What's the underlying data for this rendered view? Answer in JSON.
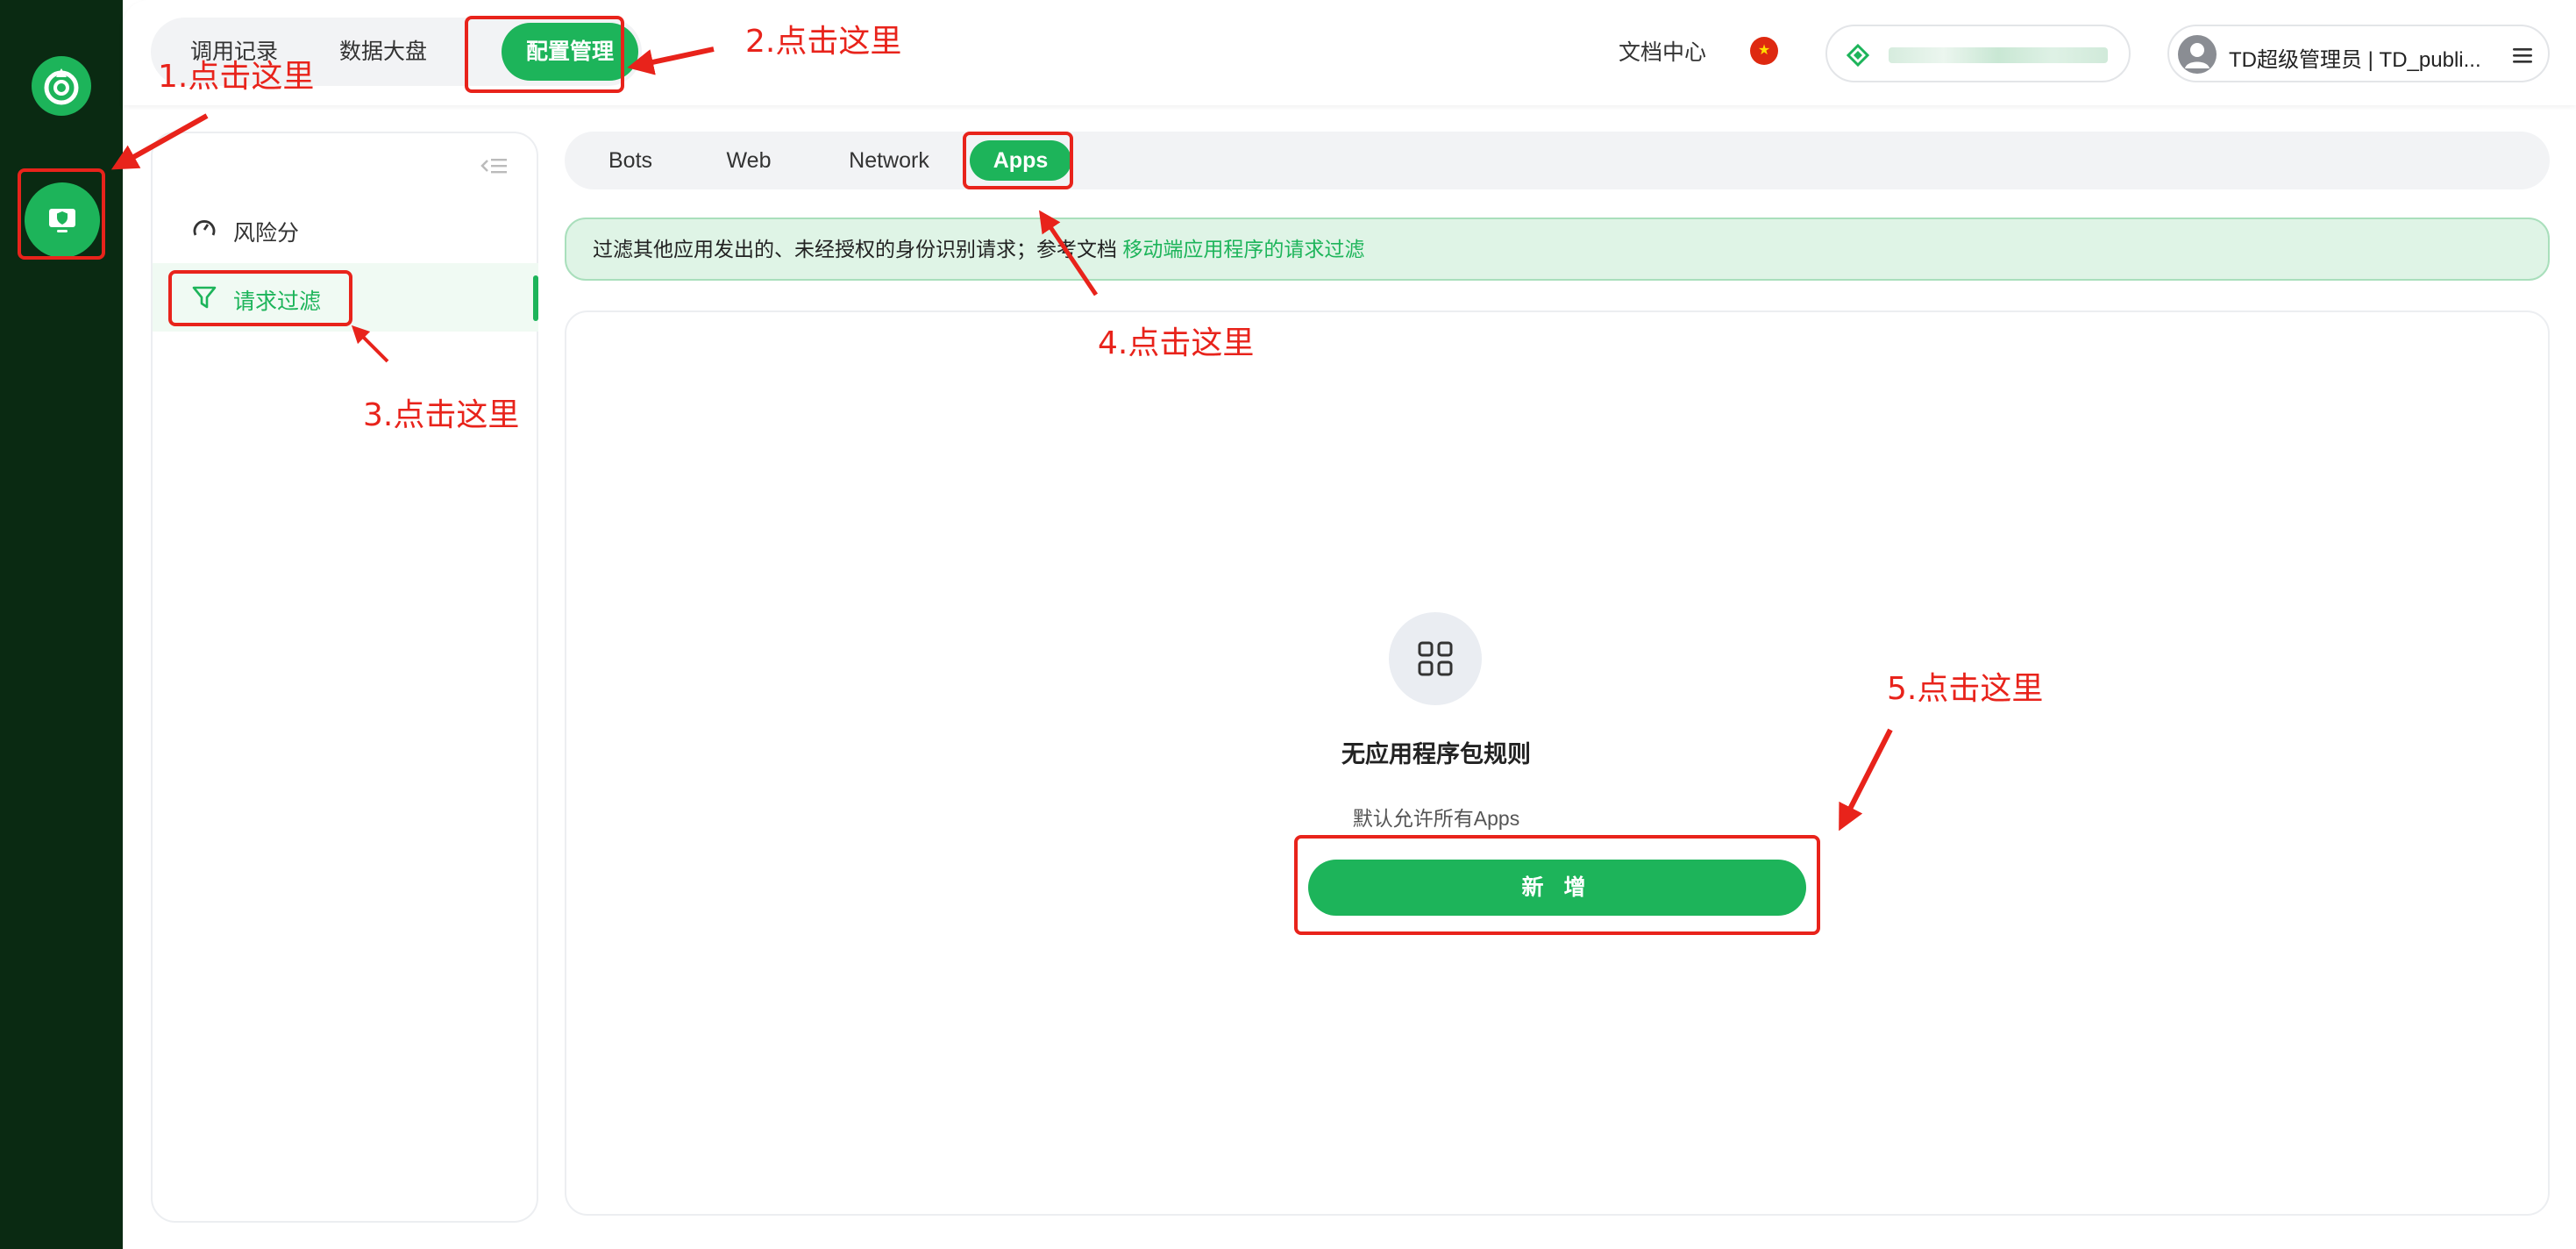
{
  "top_nav": {
    "tabs": [
      {
        "label": "调用记录"
      },
      {
        "label": "数据大盘"
      },
      {
        "label": "配置管理"
      }
    ],
    "docs_link": "文档中心",
    "user_label": "TD超级管理员 | TD_publi..."
  },
  "sidebar": {
    "items": [
      {
        "label": "风险分",
        "icon": "gauge-icon"
      },
      {
        "label": "请求过滤",
        "icon": "funnel-icon"
      }
    ]
  },
  "sub_tabs": [
    {
      "label": "Bots"
    },
    {
      "label": "Web"
    },
    {
      "label": "Network"
    },
    {
      "label": "Apps"
    }
  ],
  "notice": {
    "text": "过滤其他应用发出的、未经授权的身份识别请求；参考文档 ",
    "link": "移动端应用程序的请求过滤"
  },
  "empty_state": {
    "title": "无应用程序包规则",
    "subtitle": "默认允许所有Apps",
    "button": "新 增"
  },
  "annotations": [
    {
      "label": "1.点击这里"
    },
    {
      "label": "2.点击这里"
    },
    {
      "label": "3.点击这里"
    },
    {
      "label": "4.点击这里"
    },
    {
      "label": "5.点击这里"
    }
  ],
  "colors": {
    "brand_green": "#1db45a",
    "rail_dark": "#0a2a12",
    "annotation_red": "#e8231b"
  }
}
